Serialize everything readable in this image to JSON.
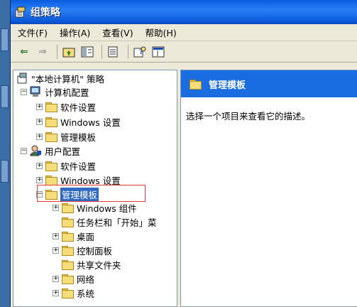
{
  "window": {
    "title": "组策略"
  },
  "menu": [
    "文件(F)",
    "操作(A)",
    "查看(V)",
    "帮助(H)"
  ],
  "toolbar": {
    "back_icon": "back-arrow-icon",
    "forward_icon": "forward-arrow-icon",
    "buttons": [
      "up-folder-icon",
      "show-tree-icon",
      "export-list-icon",
      "help-icon",
      "console-icon"
    ]
  },
  "tree": {
    "root": "\"本地计算机\" 策略",
    "computer": {
      "label": "计算机配置",
      "children": [
        "软件设置",
        "Windows 设置",
        "管理模板"
      ]
    },
    "user": {
      "label": "用户配置",
      "children": [
        "软件设置",
        "Windows 设置",
        "管理模板"
      ],
      "admin_templates_children": [
        "Windows 组件",
        "任务栏和「开始」菜",
        "桌面",
        "控制面板",
        "共享文件夹",
        "网络",
        "系统"
      ]
    }
  },
  "right": {
    "header": "管理模板",
    "description": "选择一个项目来查看它的描述。"
  },
  "colors": {
    "title_bar": "#0a5ce0",
    "selection": "#316ac5",
    "highlight_box": "#e23b3b",
    "right_header": "#1a6de0"
  }
}
